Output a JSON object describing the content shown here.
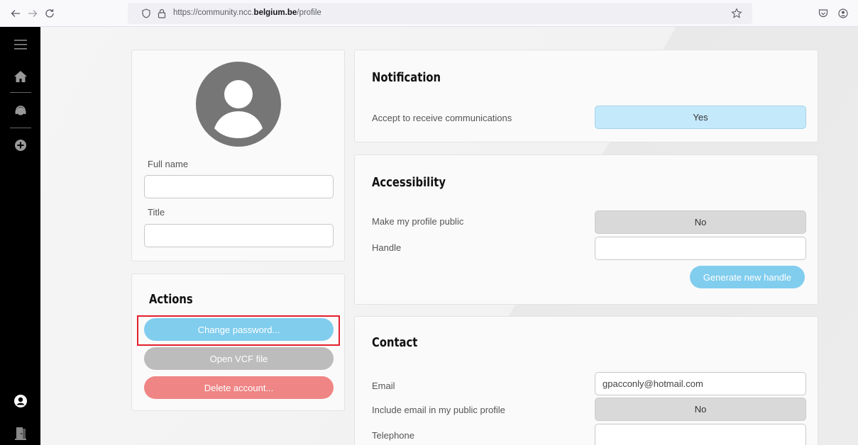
{
  "browser": {
    "url_prefix": "https://community.ncc.",
    "url_domain": "belgium.be",
    "url_path": "/profile"
  },
  "profile": {
    "full_name_label": "Full name",
    "full_name_value": "",
    "title_label": "Title",
    "title_value": ""
  },
  "actions": {
    "title": "Actions",
    "change_password": "Change password...",
    "open_vcf": "Open VCF file",
    "delete_account": "Delete account..."
  },
  "notification": {
    "title": "Notification",
    "accept_label": "Accept to receive communications",
    "accept_value": "Yes"
  },
  "accessibility": {
    "title": "Accessibility",
    "public_label": "Make my profile public",
    "public_value": "No",
    "handle_label": "Handle",
    "handle_value": "",
    "generate_handle": "Generate new handle"
  },
  "contact": {
    "title": "Contact",
    "email_label": "Email",
    "email_value": "gpacconly@hotmail.com",
    "include_email_label": "Include email in my public profile",
    "include_email_value": "No",
    "telephone_label": "Telephone",
    "telephone_value": ""
  },
  "colors": {
    "accent_blue": "#80cdee",
    "toggle_yes": "#c4e9fb",
    "danger": "#ef8585",
    "highlight": "#e3202c"
  },
  "icons": {
    "sidebar": [
      "menu-icon",
      "home-icon",
      "support-headset-icon",
      "add-circle-icon",
      "user-account-icon",
      "logout-door-icon"
    ]
  }
}
